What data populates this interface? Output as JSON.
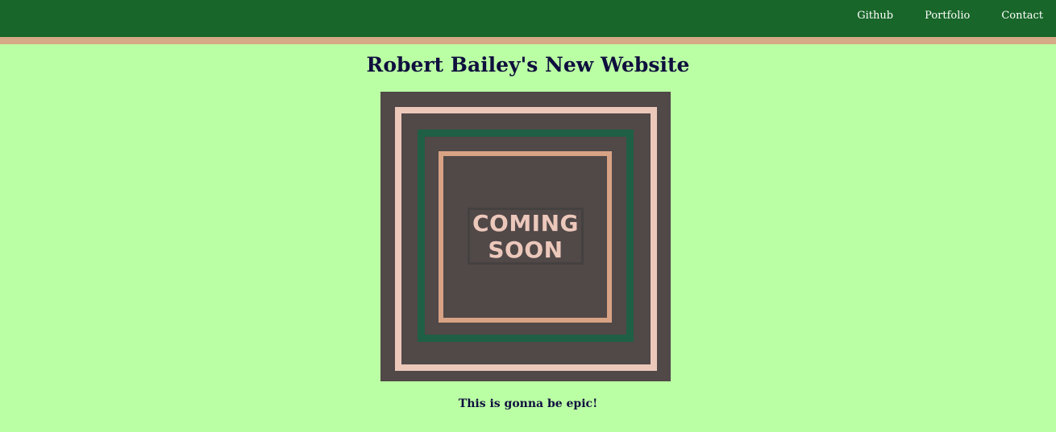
{
  "nav": {
    "links": [
      "Github",
      "Portfolio",
      "Contact"
    ]
  },
  "page": {
    "title": "Robert Bailey's New Website",
    "tagline": "This is gonna be epic!"
  },
  "hero_image": {
    "line1": "COMING",
    "line2": "SOON"
  },
  "colors": {
    "page_bg": "#bbffa4",
    "header_bg": "#186629",
    "header_stripe": "#d6aa86",
    "title_text": "#0f0f3e",
    "hero_bg": "#514848",
    "hero_outer_frame": "#ecc8bb",
    "hero_middle_frame": "#1f5f45",
    "hero_inner_frame": "#d8a385"
  }
}
